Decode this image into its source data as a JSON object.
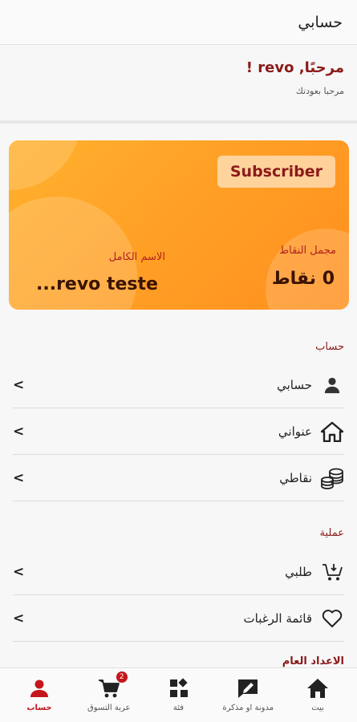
{
  "header": {
    "title": "حسابي"
  },
  "greeting": {
    "hello": "مرحبًا, revo !",
    "subtitle": "مرحبا بعودتك"
  },
  "card": {
    "badge": "Subscriber",
    "points_label": "مجمل النقاط",
    "points_value": "0 نقاط",
    "name_label": "الاسم الكامل",
    "name_value": "...revo teste"
  },
  "sections": {
    "account": {
      "title": "حساب",
      "items": [
        {
          "label": "حسابي",
          "icon": "person-icon"
        },
        {
          "label": "عنواني",
          "icon": "home-icon"
        },
        {
          "label": "نقاطي",
          "icon": "coins-icon"
        }
      ]
    },
    "orders": {
      "title": "عملية",
      "items": [
        {
          "label": "طلبي",
          "icon": "cart-down-icon"
        },
        {
          "label": "قائمة الرغبات",
          "icon": "heart-icon"
        }
      ]
    },
    "general": {
      "title": "الاعداد العام"
    }
  },
  "nav": {
    "items": [
      {
        "label": "حساب",
        "icon": "person-icon",
        "active": true
      },
      {
        "label": "عربة التسوق",
        "icon": "cart-icon",
        "badge": "2"
      },
      {
        "label": "فئة",
        "icon": "category-icon"
      },
      {
        "label": "مدونة او مذكرة",
        "icon": "blog-icon"
      },
      {
        "label": "بيت",
        "icon": "home-icon"
      }
    ]
  },
  "colors": {
    "accent": "#8b1a1a",
    "active": "#c4161c",
    "card_orange": "#ff9d24"
  }
}
